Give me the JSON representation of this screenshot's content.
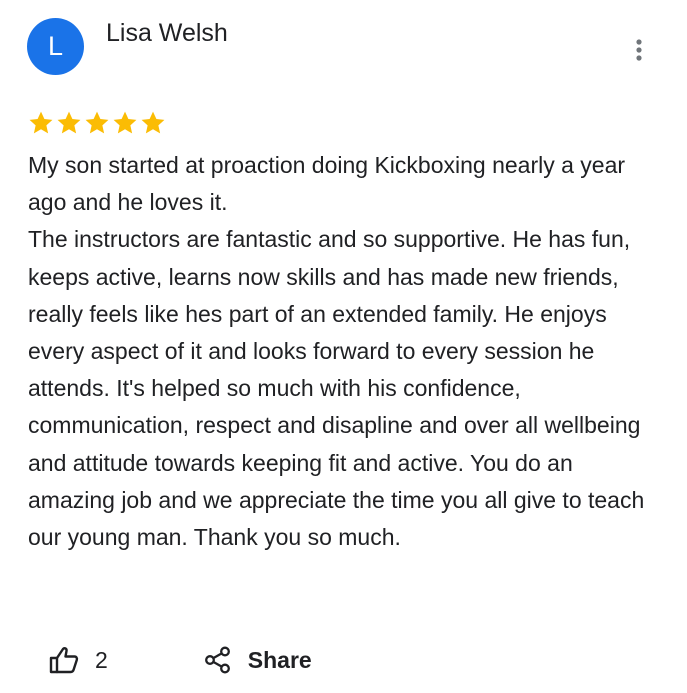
{
  "review": {
    "avatar_initial": "L",
    "avatar_color": "#1a73e8",
    "reviewer_name": "Lisa Welsh",
    "rating": 5,
    "rating_max": 5,
    "star_color": "#fbbc04",
    "text": "My son started at proaction doing Kickboxing nearly a year ago and he loves it.\nThe instructors are fantastic and so supportive. He has fun, keeps active, learns now skills and has made new friends, really feels like hes part of an extended family. He enjoys every aspect of it and looks forward to every session he attends. It's helped so much with his confidence, communication, respect and disapline and over all wellbeing and attitude towards keeping fit and active. You do an amazing job and we appreciate the time you all give to teach our young man. Thank you so much."
  },
  "actions": {
    "like_count": "2",
    "share_label": "Share"
  },
  "icons": {
    "more": "more-vert-icon",
    "star": "star-icon",
    "like": "thumb-up-icon",
    "share": "share-icon"
  }
}
